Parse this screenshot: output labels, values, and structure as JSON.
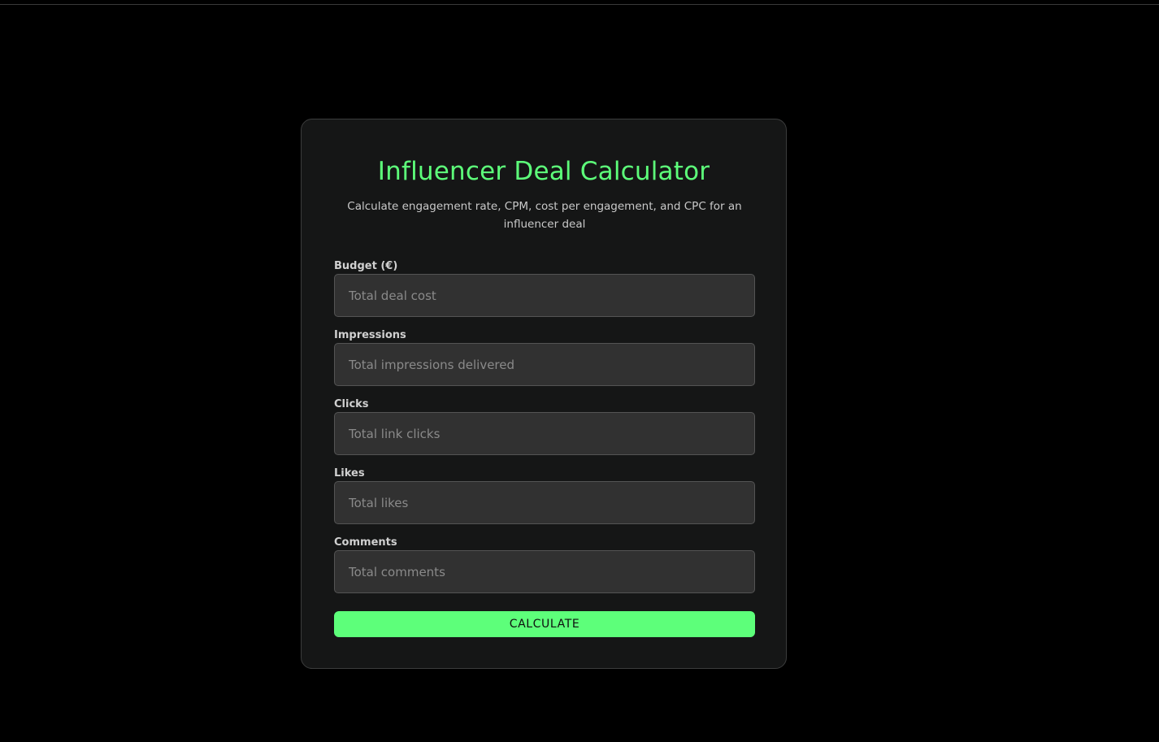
{
  "colors": {
    "page_background": "#000000",
    "card_background": "#151616",
    "accent": "#5dff7a",
    "input_background": "#313131"
  },
  "calculator": {
    "title": "Influencer Deal Calculator",
    "subtitle": "Calculate engagement rate, CPM, cost per engagement, and CPC for an influencer deal",
    "fields": [
      {
        "label": "Budget (€)",
        "value": "",
        "placeholder": "Total deal cost"
      },
      {
        "label": "Impressions",
        "value": "",
        "placeholder": "Total impressions delivered"
      },
      {
        "label": "Clicks",
        "value": "",
        "placeholder": "Total link clicks"
      },
      {
        "label": "Likes",
        "value": "",
        "placeholder": "Total likes"
      },
      {
        "label": "Comments",
        "value": "",
        "placeholder": "Total comments"
      }
    ],
    "button_label": "CALCULATE"
  }
}
